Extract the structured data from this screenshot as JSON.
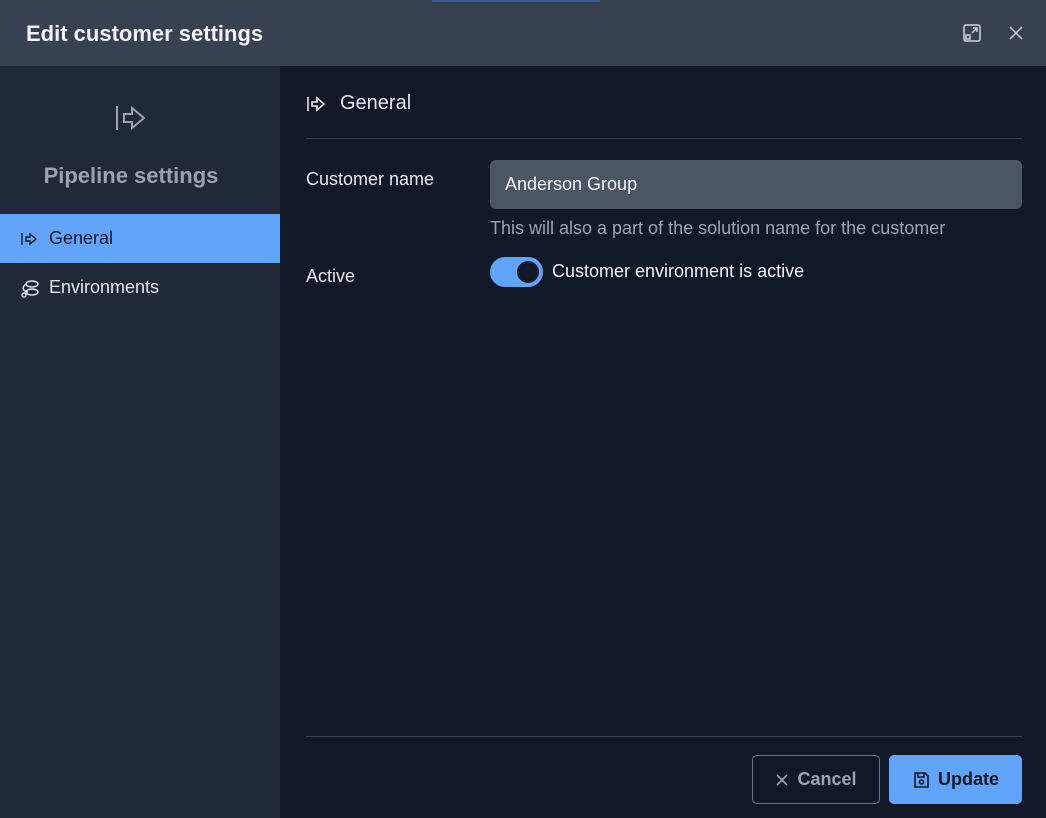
{
  "dialog": {
    "title": "Edit customer settings"
  },
  "sidebar": {
    "heading": "Pipeline settings",
    "items": [
      {
        "label": "General",
        "icon": "enter-arrow-icon",
        "active": true
      },
      {
        "label": "Environments",
        "icon": "environments-icon",
        "active": false
      }
    ]
  },
  "main": {
    "section_title": "General",
    "customer_name": {
      "label": "Customer name",
      "value": "Anderson Group",
      "hint": "This will also a part of the solution name for the customer"
    },
    "active": {
      "label": "Active",
      "toggle_on": true,
      "toggle_label": "Customer environment is active"
    }
  },
  "footer": {
    "cancel_label": "Cancel",
    "update_label": "Update"
  },
  "colors": {
    "accent": "#60a5fa",
    "header_bg": "#374151",
    "sidebar_bg": "#1f2937",
    "main_bg": "#111827"
  }
}
